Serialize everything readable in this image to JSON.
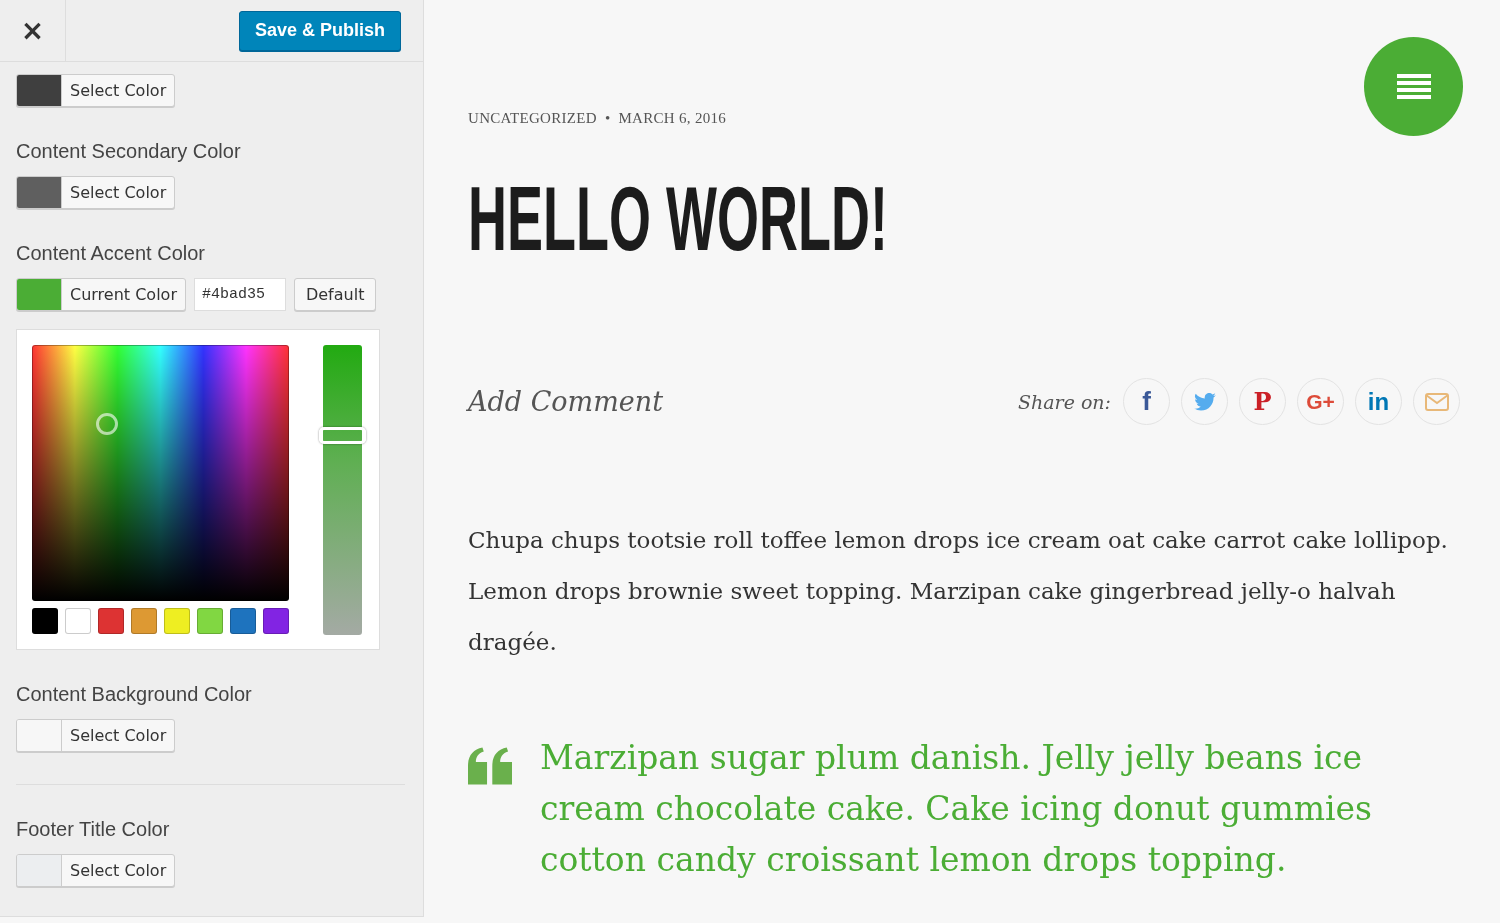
{
  "sidebar": {
    "close_button": "×",
    "save_button": "Save & Publish",
    "controls": [
      {
        "kind": "color",
        "color": "#3f3f3f",
        "button": "Select Color",
        "expanded": false
      },
      {
        "kind": "color",
        "label": "Content Secondary Color",
        "color": "#5f5f5f",
        "button": "Select Color",
        "expanded": false
      },
      {
        "kind": "color",
        "label": "Content Accent Color",
        "color": "#4bad35",
        "button": "Current Color",
        "expanded": true,
        "hex_value": "#4bad35",
        "default_button": "Default",
        "palette": [
          {
            "color": "#000000"
          },
          {
            "color": "#ffffff"
          },
          {
            "color": "#dd3333"
          },
          {
            "color": "#dd9933"
          },
          {
            "color": "#eeee22"
          },
          {
            "color": "#81d742"
          },
          {
            "color": "#1e73be"
          },
          {
            "color": "#8224e3"
          }
        ],
        "lightness": {
          "level": 0.69
        }
      },
      {
        "kind": "color",
        "label": "Content Background Color",
        "color": "#f7f7f7",
        "button": "Select Color",
        "expanded": false
      },
      {
        "kind": "divider"
      },
      {
        "kind": "color",
        "label": "Footer Title Color",
        "color": "#eceef0",
        "button": "Select Color",
        "expanded": false
      }
    ]
  },
  "preview": {
    "meta": {
      "category": "UNCATEGORIZED",
      "separator": "•",
      "date": "MARCH 6, 2016"
    },
    "title": "HELLO WORLD!",
    "add_comment": "Add Comment",
    "share": {
      "label": "Share on:",
      "buttons": [
        {
          "kind": "facebook",
          "glyph": "f",
          "color": "#3b5998"
        },
        {
          "kind": "twitter",
          "color": "#55acee"
        },
        {
          "kind": "pinterest",
          "glyph": "P",
          "color": "#cb2027"
        },
        {
          "kind": "google",
          "glyph": "G+",
          "color": "#dd4b39"
        },
        {
          "kind": "linkedin",
          "glyph": "in",
          "color": "#0077b5"
        },
        {
          "kind": "email",
          "color": "#e8b878"
        }
      ]
    },
    "paragraph": "Chupa chups tootsie roll toffee lemon drops ice cream oat cake carrot cake lollipop. Lemon drops brownie sweet topping. Marzipan cake gingerbread jelly-o halvah dragée.",
    "quote": "Marzipan sugar plum danish. Jelly jelly beans ice cream chocolate cake. Cake icing donut gummies cotton candy croissant lemon drops topping."
  }
}
